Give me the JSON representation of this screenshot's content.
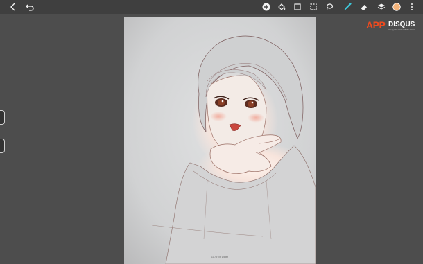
{
  "app": {
    "toolbar": {
      "left_icons": [
        "back-arrow-icon",
        "undo-icon"
      ],
      "right_icons": [
        "add-circle-icon",
        "fill-bucket-icon",
        "crop-icon",
        "selection-icon",
        "lasso-icon",
        "brush-icon",
        "eraser-icon",
        "layers-icon",
        "color-swatch-icon",
        "more-icon"
      ],
      "active_tool": "brush",
      "accent_color": "#3ec6d8",
      "swatch_color": "#f3b37a"
    },
    "side_controls": [
      "brush-size-slider",
      "opacity-slider"
    ]
  },
  "canvas": {
    "background": "#cfd0d1",
    "caption": "1179 px width"
  },
  "watermark": {
    "brand_app": "APP",
    "brand_disqus": "DISQUS",
    "tagline": "Always be first with the latest"
  }
}
